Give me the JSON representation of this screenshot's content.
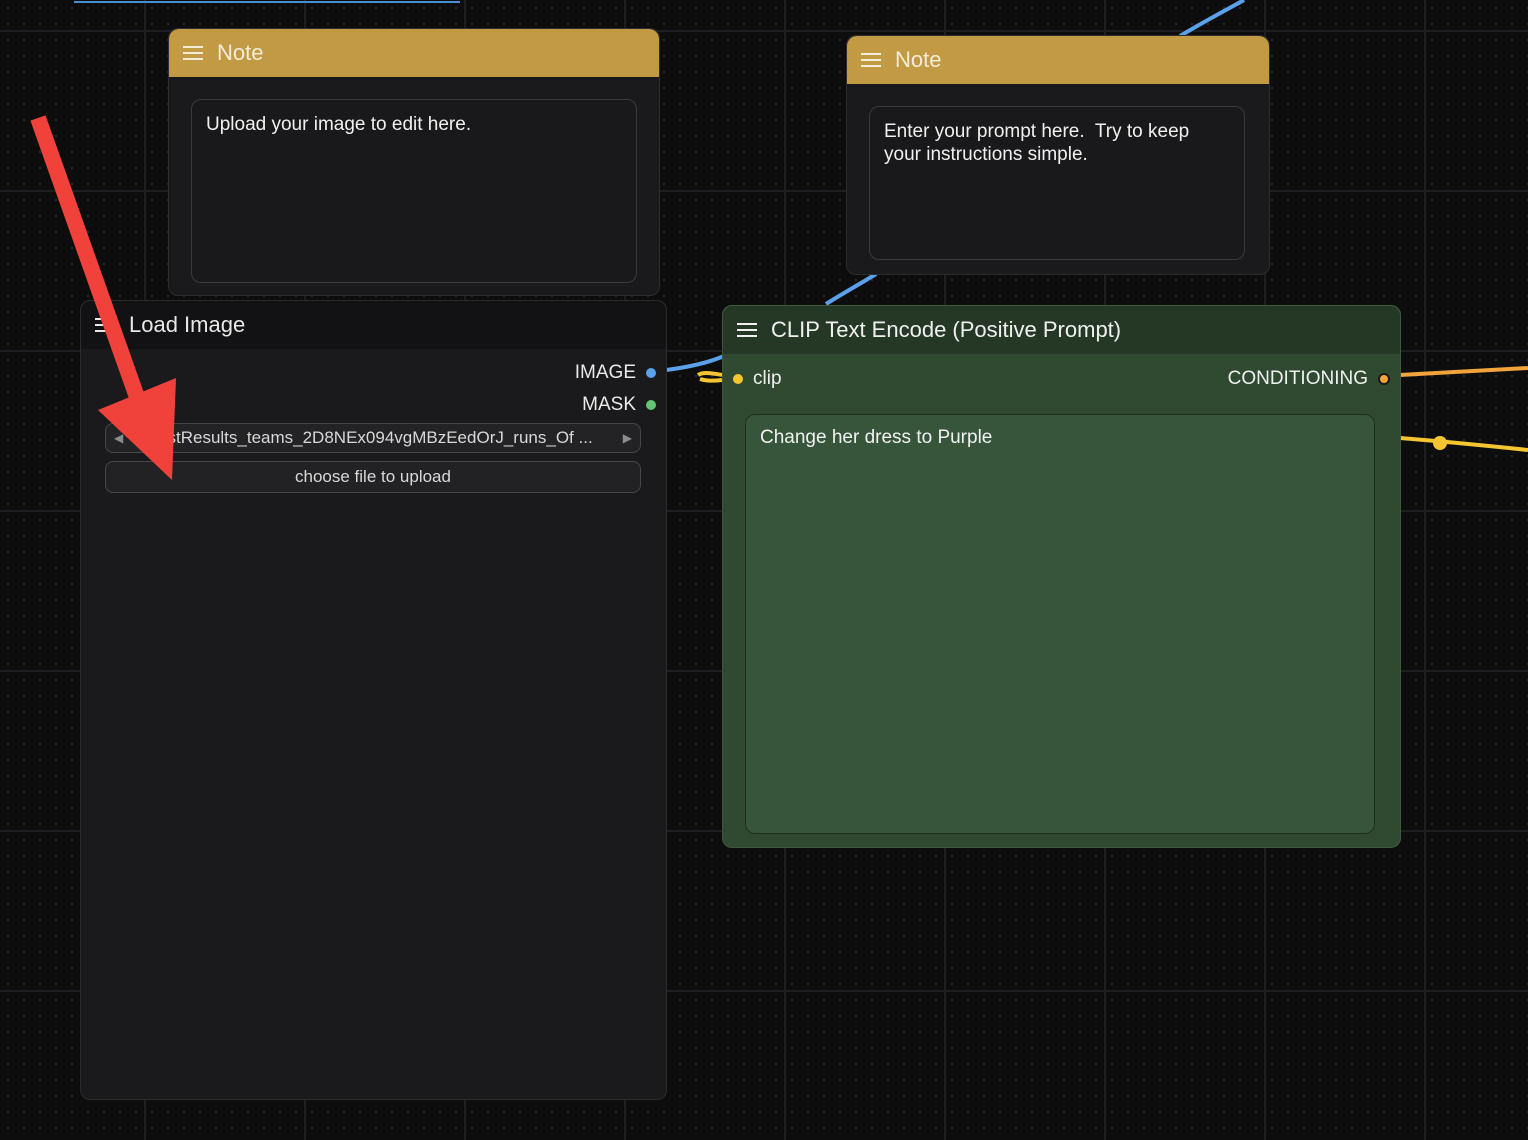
{
  "canvas": {
    "wire_colors": {
      "image": "#5aa0ea",
      "clip": "#f4c531",
      "conditioning": "#f2a33a"
    }
  },
  "note_upload": {
    "title": "Note",
    "text": "Upload your image to edit here."
  },
  "note_prompt": {
    "title": "Note",
    "text": "Enter your prompt here.  Try to keep\nyour instructions simple."
  },
  "load_image": {
    "title": "Load Image",
    "outputs": [
      {
        "label": "IMAGE",
        "color": "#5aa0ea"
      },
      {
        "label": "MASK",
        "color": "#63c574"
      }
    ],
    "image_value": "testResults_teams_2D8NEx094vgMBzEedOrJ_runs_Of ...",
    "upload_label": "choose file to upload"
  },
  "clip_encode": {
    "title": "CLIP Text Encode (Positive Prompt)",
    "input": {
      "label": "clip",
      "color": "#f4c531"
    },
    "output": {
      "label": "CONDITIONING",
      "color": "#f2a33a"
    },
    "text": "Change her dress to Purple"
  },
  "annotation": {
    "arrow_color": "#f0423a"
  }
}
